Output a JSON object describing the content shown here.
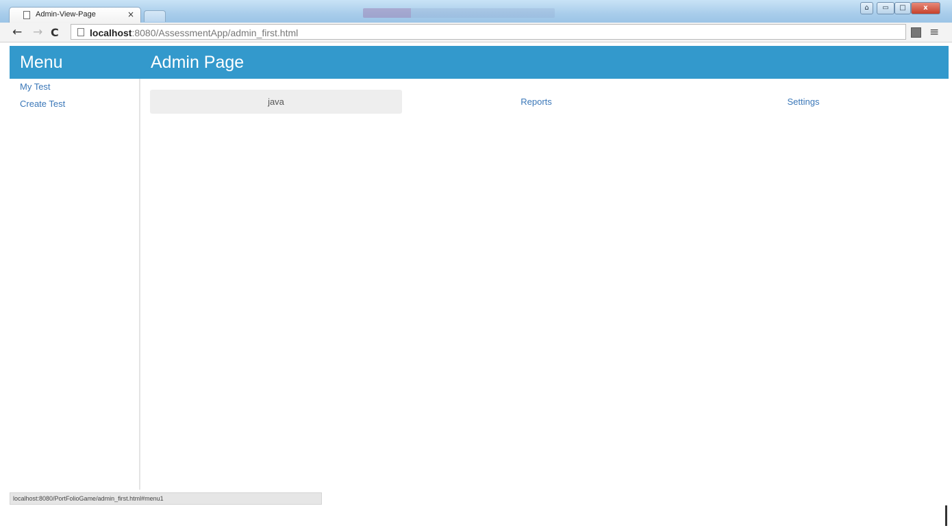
{
  "browser": {
    "tab_title": "Admin-View-Page",
    "tab_close": "×",
    "url_host": "localhost",
    "url_rest": ":8080/AssessmentApp/admin_first.html",
    "status_url": "localhost:8080/PortFolioGame/admin_first.html#menu1",
    "icons": {
      "back": "←",
      "forward": "→",
      "reload": "C",
      "menu": "≡",
      "minimize": "▭",
      "maximize": "□",
      "close": "x"
    }
  },
  "sidebar": {
    "header": "Menu",
    "items": [
      {
        "label": "My Test"
      },
      {
        "label": "Create Test"
      }
    ]
  },
  "main": {
    "header": "Admin Page",
    "tabs": [
      {
        "label": "java",
        "active": true
      },
      {
        "label": "Reports",
        "active": false
      },
      {
        "label": "Settings",
        "active": false
      }
    ]
  },
  "colors": {
    "header_bg": "#3399cc",
    "link": "#3a77b8",
    "active_tab_bg": "#eeeeee"
  }
}
